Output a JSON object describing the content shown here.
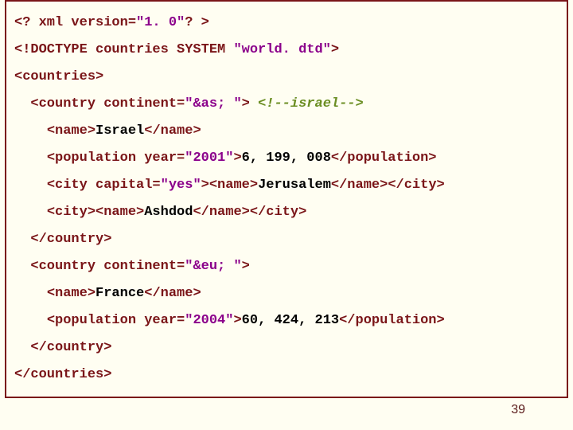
{
  "page_number": "39",
  "code": {
    "l0": {
      "t1": "<? xml version=",
      "v1": "\"1. 0\"",
      "t2": "? >"
    },
    "l1": {
      "t1": "<!DOCTYPE countries SYSTEM ",
      "v1": "\"world. dtd\"",
      "t2": ">"
    },
    "l2": {
      "t1": "<countries>"
    },
    "l3": {
      "sp": "  ",
      "t1": "<country continent=",
      "v1": "\"&as; \"",
      "t2": "> ",
      "c1": "<!--israel-->"
    },
    "l4": {
      "sp": "    ",
      "t1": "<name>",
      "x1": "Israel",
      "t2": "</name>"
    },
    "l5": {
      "sp": "    ",
      "t1": "<population year=",
      "v1": "\"2001\"",
      "t2": ">",
      "x1": "6, 199, 008",
      "t3": "</population>"
    },
    "l6": {
      "sp": "    ",
      "t1": "<city capital=",
      "v1": "\"yes\"",
      "t2": "><name>",
      "x1": "Jerusalem",
      "t3": "</name></city>"
    },
    "l7": {
      "sp": "    ",
      "t1": "<city><name>",
      "x1": "Ashdod",
      "t2": "</name></city>"
    },
    "l8": {
      "sp": "  ",
      "t1": "</country>"
    },
    "l9": {
      "sp": "  ",
      "t1": "<country continent=",
      "v1": "\"&eu; \"",
      "t2": ">"
    },
    "l10": {
      "sp": "    ",
      "t1": "<name>",
      "x1": "France",
      "t2": "</name>"
    },
    "l11": {
      "sp": "    ",
      "t1": "<population year=",
      "v1": "\"2004\"",
      "t2": ">",
      "x1": "60, 424, 213",
      "t3": "</population>"
    },
    "l12": {
      "sp": "  ",
      "t1": "</country>"
    },
    "l13": {
      "t1": "</countries>"
    }
  }
}
